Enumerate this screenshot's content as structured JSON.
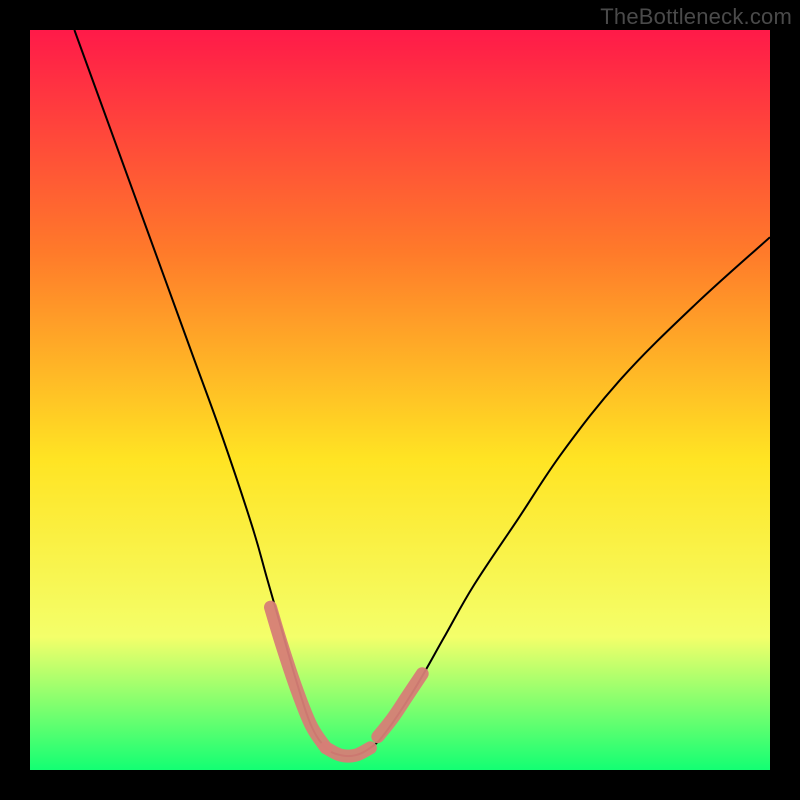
{
  "watermark": "TheBottleneck.com",
  "chart_data": {
    "type": "line",
    "title": "",
    "xlabel": "",
    "ylabel": "",
    "xlim": [
      0,
      100
    ],
    "ylim": [
      0,
      100
    ],
    "grid": false,
    "legend": false,
    "background_gradient": {
      "top": "#ff1a49",
      "upper_mid": "#ff7a2a",
      "mid": "#ffe423",
      "lower_mid": "#f4ff6a",
      "bottom": "#13ff73"
    },
    "series": [
      {
        "name": "bottleneck-curve",
        "stroke": "#000000",
        "x": [
          6,
          10,
          14,
          18,
          22,
          26,
          30,
          32,
          34,
          36,
          38,
          40,
          42,
          44,
          46,
          48,
          52,
          56,
          60,
          66,
          72,
          80,
          90,
          100
        ],
        "y": [
          100,
          89,
          78,
          67,
          56,
          45,
          33,
          26,
          19,
          12,
          6,
          3,
          2,
          2,
          3,
          5,
          11,
          18,
          25,
          34,
          43,
          53,
          63,
          72
        ]
      }
    ],
    "highlight_segments": [
      {
        "name": "left-descent-highlight",
        "stroke": "#d77f77",
        "x": [
          32.5,
          34,
          36,
          38,
          40
        ],
        "y": [
          22,
          17,
          11,
          6,
          3
        ]
      },
      {
        "name": "valley-floor-highlight",
        "stroke": "#d77f77",
        "x": [
          40,
          42,
          44,
          46
        ],
        "y": [
          3,
          2,
          2,
          3
        ]
      },
      {
        "name": "right-ascent-highlight",
        "stroke": "#d77f77",
        "x": [
          47,
          49,
          51,
          53
        ],
        "y": [
          4.5,
          7,
          10,
          13
        ]
      }
    ]
  }
}
